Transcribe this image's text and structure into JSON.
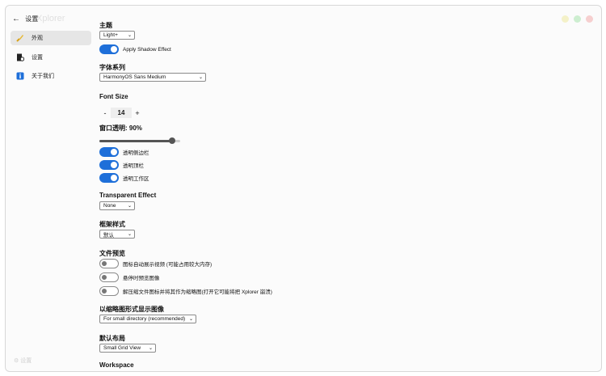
{
  "app": {
    "title": "Xplorer"
  },
  "sidebar": {
    "back_label": "设置",
    "items": [
      {
        "label": "外观",
        "icon": "paint-brush-icon",
        "active": true
      },
      {
        "label": "设置",
        "icon": "settings-file-icon",
        "active": false
      },
      {
        "label": "关于我们",
        "icon": "info-icon",
        "active": false
      }
    ],
    "bottom_label": "设置"
  },
  "settings": {
    "theme": {
      "label": "主题",
      "value": "Light+"
    },
    "shadow_toggle": {
      "label": "Apply Shadow Effect",
      "on": true
    },
    "font_family": {
      "label": "字体系列",
      "value": "HarmonyOS Sans Medium"
    },
    "font_size": {
      "label": "Font Size",
      "minus": "-",
      "value": "14",
      "plus": "+"
    },
    "opacity": {
      "label": "窗口透明: 90%",
      "value_percent": 90
    },
    "transparency_toggles": [
      {
        "label": "透明侧边栏",
        "on": true
      },
      {
        "label": "透明顶栏",
        "on": true
      },
      {
        "label": "透明工作区",
        "on": true
      }
    ],
    "transparent_effect": {
      "label": "Transparent Effect",
      "value": "None"
    },
    "frame_style": {
      "label": "框架样式",
      "value": "默认"
    },
    "file_preview": {
      "label": "文件预览",
      "toggles": [
        {
          "label": "图标自动展示视频 (可能占用较大内存)",
          "on": false
        },
        {
          "label": "悬停时预览图像",
          "on": false
        },
        {
          "label": "解压缩文件图标并将其作为缩略图(打开它可能将把 Xplorer 崩溃)",
          "on": false
        }
      ]
    },
    "thumbnail": {
      "label": "以缩略图形式显示图像",
      "value": "For small directory (recommended)"
    },
    "default_layout": {
      "label": "默认布局",
      "value": "Small Grid View"
    },
    "workspace": {
      "label": "Workspace"
    }
  },
  "colors": {
    "accent": "#1e6fd9"
  }
}
